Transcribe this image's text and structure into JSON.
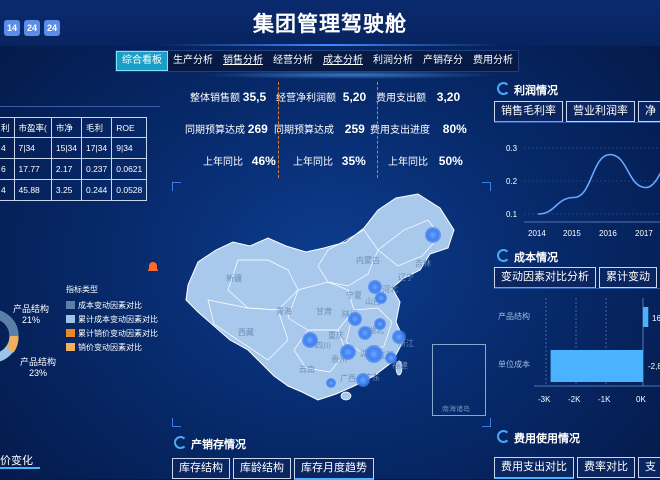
{
  "header": {
    "title": "集团管理驾驶舱",
    "dates": [
      "14",
      "24",
      "24"
    ]
  },
  "nav": {
    "tabs": [
      "综合看板",
      "生产分析",
      "销售分析",
      "经营分析",
      "成本分析",
      "利润分析",
      "产销存分",
      "费用分析"
    ]
  },
  "left_table": {
    "headers": [
      "利",
      "市盈率(",
      "市净",
      "毛利",
      "ROE"
    ],
    "rows": [
      [
        "4",
        "7|34",
        "15|34",
        "17|34",
        "9|34"
      ],
      [
        "6",
        "17.77",
        "2.17",
        "0.237",
        "0.0621"
      ],
      [
        "4",
        "45.88",
        "3.25",
        "0.244",
        "0.0528"
      ]
    ]
  },
  "kpis": {
    "sales_label": "整体销售额",
    "sales_value": "35,5",
    "net_profit_label": "经营净利润额",
    "net_profit_value": "5,20",
    "expense_label": "费用支出额",
    "expense_value": "3,20",
    "budget1_label": "同期预算达成",
    "budget1_value": "269",
    "budget2_label": "同期预算达成",
    "budget2_value": "259",
    "exp_progress_label": "费用支出进度",
    "exp_progress_value": "80%",
    "yoy1_label": "上年同比",
    "yoy1_value": "46%",
    "yoy2_label": "上年同比",
    "yoy2_value": "35%",
    "yoy3_label": "上年同比",
    "yoy3_value": "50%"
  },
  "map": {
    "provinces": [
      "新疆",
      "西藏",
      "青海",
      "甘肃",
      "内蒙古",
      "四川",
      "云南",
      "贵州",
      "湖南",
      "广西",
      "宁夏",
      "陕西",
      "山西",
      "河北",
      "吉林",
      "辽宁",
      "重庆",
      "广东",
      "江西",
      "福建",
      "湖北",
      "浙江"
    ],
    "inset_label": "南海诸岛"
  },
  "profit": {
    "title": "利润情况",
    "tabs": [
      "销售毛利率",
      "营业利润率",
      "净"
    ]
  },
  "cost": {
    "title": "成本情况",
    "tabs": [
      "变动因素对比分析",
      "累计变动"
    ]
  },
  "expense": {
    "title": "费用使用情况",
    "tabs": [
      "费用支出对比",
      "费率对比",
      "支"
    ]
  },
  "production": {
    "title": "产销存情况",
    "tabs": [
      "库存结构",
      "库龄结构",
      "库存月度趋势"
    ]
  },
  "donut": {
    "label1": "产品结构",
    "pct1": "21%",
    "label2": "产品结构",
    "pct2": "23%"
  },
  "legend": {
    "title": "指标类型",
    "items": [
      {
        "label": "成本变动因素对比",
        "color": "#5b7fa6"
      },
      {
        "label": "累计成本变动因素对比",
        "color": "#9cc3e8"
      },
      {
        "label": "累计销价变动因素对比",
        "color": "#e88a2a"
      },
      {
        "label": "销价变动因素对比",
        "color": "#f0b060"
      }
    ]
  },
  "bottom_left": {
    "title": "价变化"
  },
  "chart_data": [
    {
      "type": "line",
      "title": "",
      "x": [
        "2014",
        "2015",
        "2016",
        "2017"
      ],
      "y_ticks": [
        "0.1",
        "0.2",
        "0.3"
      ],
      "ylim": [
        0.1,
        0.3
      ],
      "series": [
        {
          "values": [
            0.1,
            0.15,
            0.28,
            0.18
          ]
        }
      ],
      "color": "#6aa6ff"
    },
    {
      "type": "bar",
      "orientation": "horizontal",
      "categories": [
        "产品结构",
        "单位成本"
      ],
      "values": [
        160,
        -2800
      ],
      "value_labels": [
        "16",
        "-2,8"
      ],
      "x_ticks": [
        "-3K",
        "-2K",
        "-1K",
        "0K"
      ],
      "xlim": [
        -3000,
        0
      ],
      "color": "#4ab3ff"
    }
  ]
}
